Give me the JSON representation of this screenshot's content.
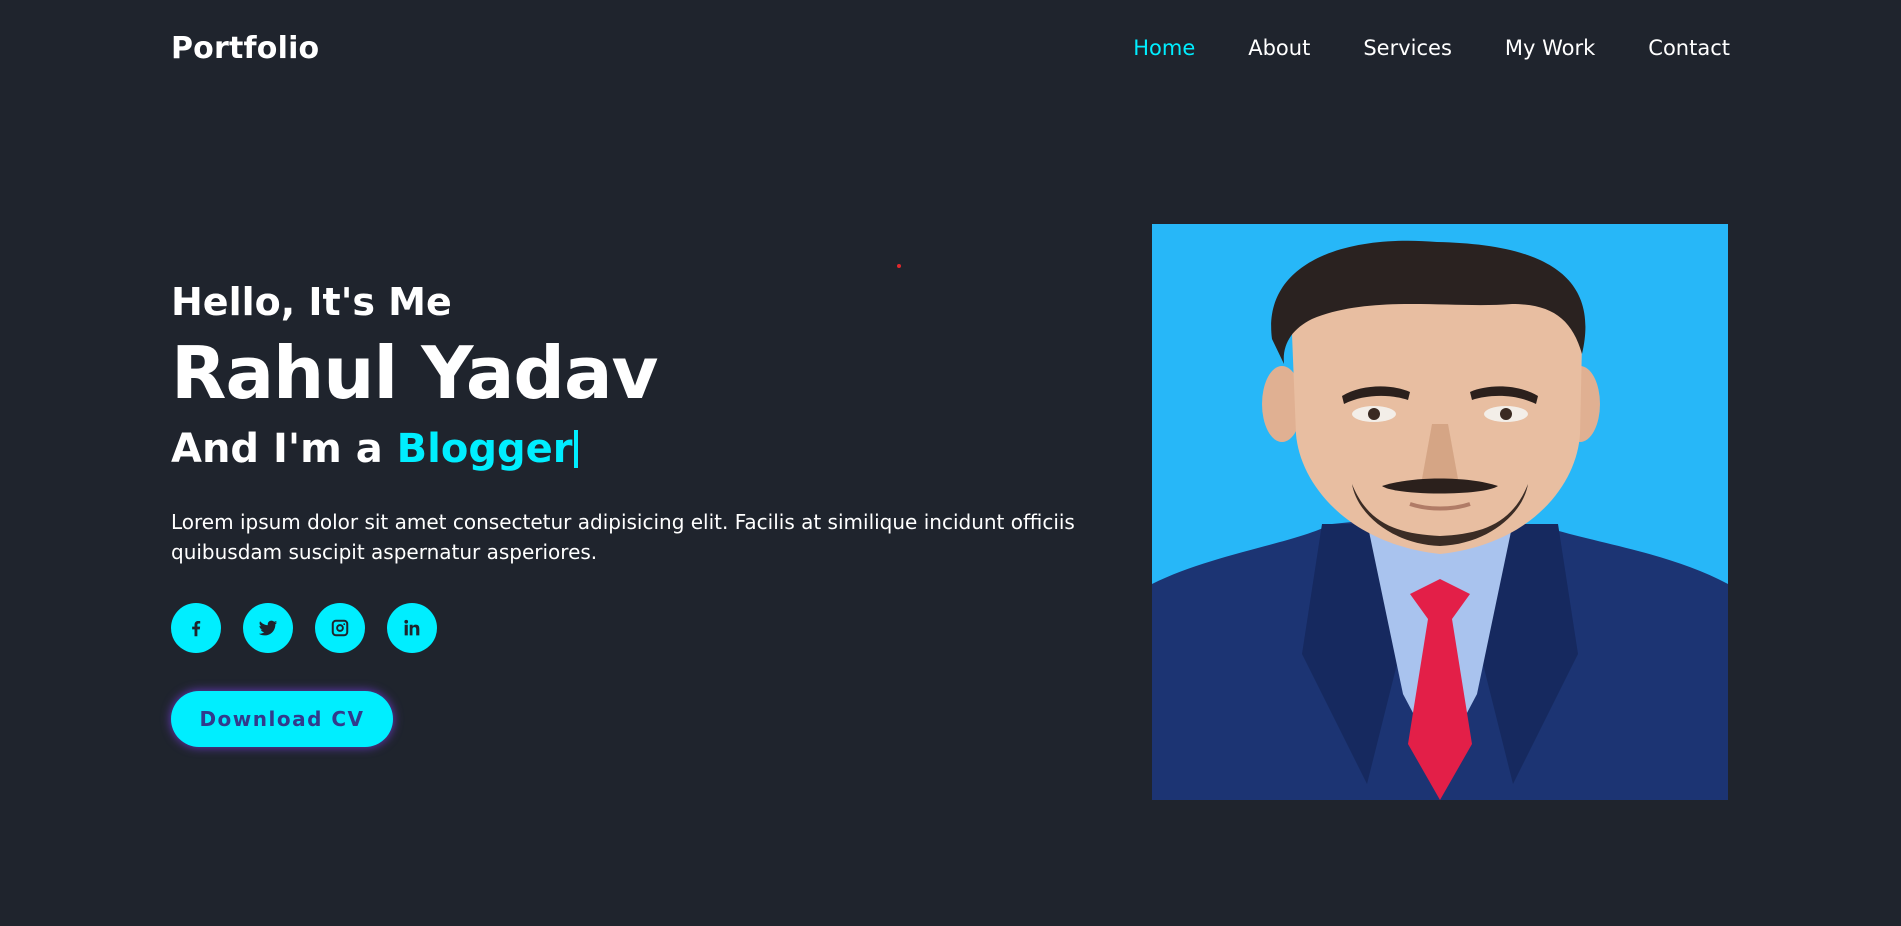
{
  "header": {
    "logo": "Portfolio",
    "nav": [
      {
        "label": "Home",
        "active": true
      },
      {
        "label": "About",
        "active": false
      },
      {
        "label": "Services",
        "active": false
      },
      {
        "label": "My Work",
        "active": false
      },
      {
        "label": "Contact",
        "active": false
      }
    ]
  },
  "home": {
    "greeting": "Hello, It's Me",
    "name": "Rahul Yadav",
    "role_prefix": "And I'm a ",
    "role": "Blogger",
    "description": "Lorem ipsum dolor sit amet consectetur adipisicing elit. Facilis at similique incidunt officiis quibusdam suscipit aspernatur asperiores.",
    "social_icons": [
      "facebook-icon",
      "twitter-icon",
      "instagram-icon",
      "linkedin-icon"
    ],
    "download_label": "Download CV"
  },
  "colors": {
    "background": "#1f242d",
    "accent": "#00eeff",
    "text": "#ffffff",
    "photo_background": "#27b7f8"
  }
}
